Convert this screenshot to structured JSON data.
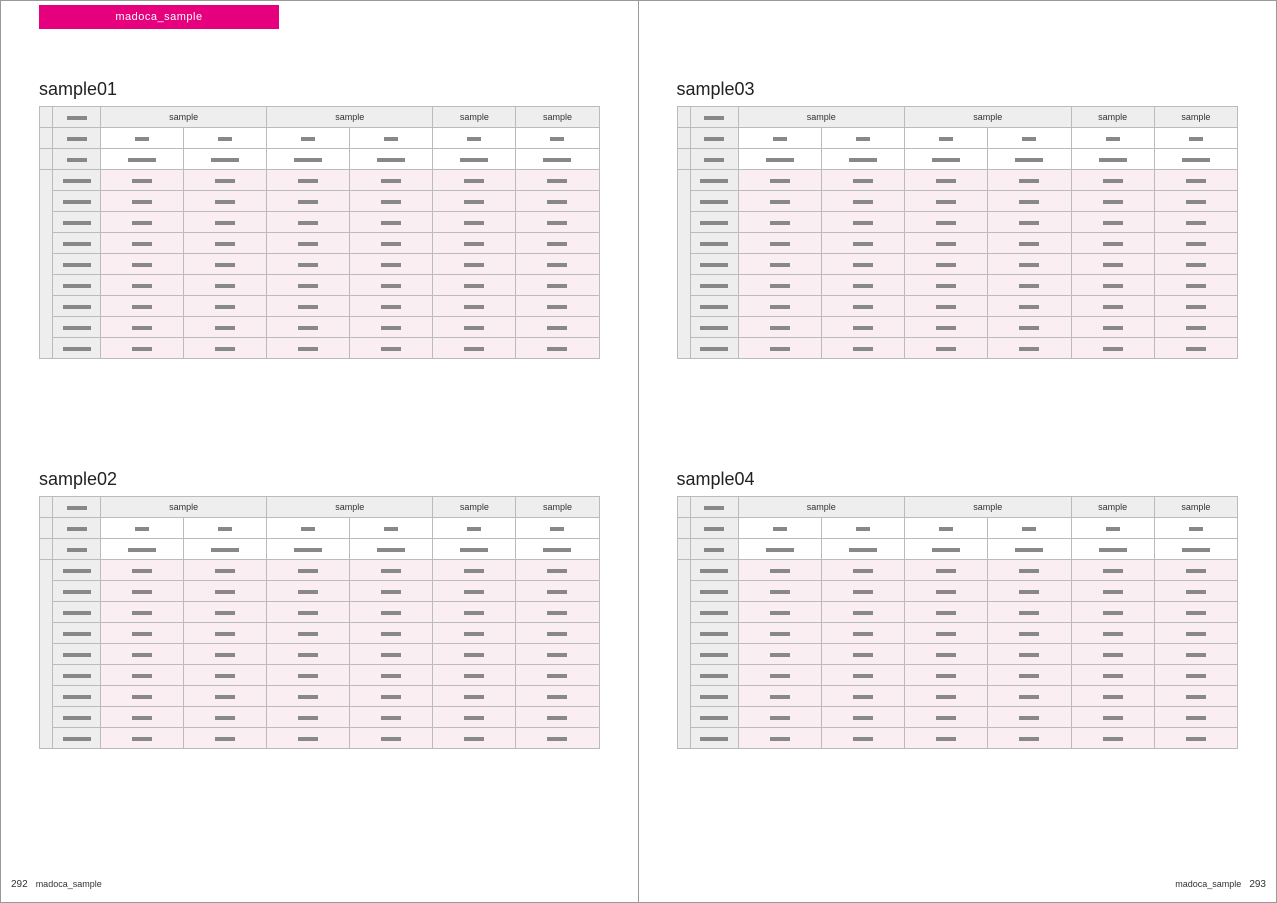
{
  "tab_label": "madoca_sample",
  "footer_label": "madoca_sample",
  "page_left_num": "292",
  "page_right_num": "293",
  "sections": [
    {
      "title": "sample01",
      "headers": [
        "sample",
        "sample",
        "sample",
        "sample"
      ]
    },
    {
      "title": "sample02",
      "headers": [
        "sample",
        "sample",
        "sample",
        "sample"
      ]
    },
    {
      "title": "sample03",
      "headers": [
        "sample",
        "sample",
        "sample",
        "sample"
      ]
    },
    {
      "title": "sample04",
      "headers": [
        "sample",
        "sample",
        "sample",
        "sample"
      ]
    }
  ],
  "body_rows": 9
}
